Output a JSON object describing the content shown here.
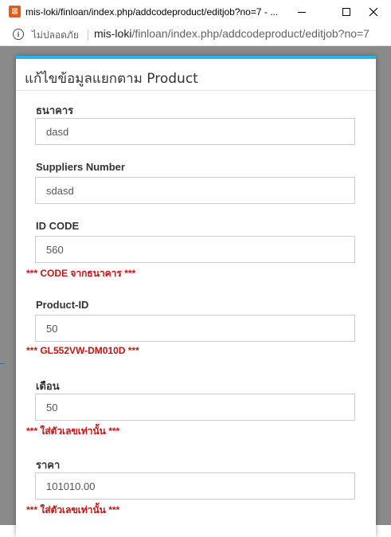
{
  "window": {
    "title": "mis-loki/finloan/index.php/addcodeproduct/editjob?no=7 - ...",
    "icon": "xampp-icon"
  },
  "addressbar": {
    "security_label": "ไม่ปลอดภัย",
    "url_host": "mis-loki",
    "url_path": "/finloan/index.php/addcodeproduct/editjob?no=7"
  },
  "modal": {
    "title": "แก้ไขข้อมูลแยกตาม Product",
    "accent_color": "#27b4e9",
    "fields": [
      {
        "label": "ธนาคาร",
        "value": "dasd",
        "hint": ""
      },
      {
        "label": "Suppliers Number",
        "value": "sdasd",
        "hint": ""
      },
      {
        "label": "ID CODE",
        "value": "560",
        "hint": "*** CODE จากธนาคาร ***"
      },
      {
        "label": "Product-ID",
        "value": "50",
        "hint": "*** GL552VW-DM010D ***"
      },
      {
        "label": "เดือน",
        "value": "50",
        "hint": "*** ใส่ตัวเลขเท่านั้น ***"
      },
      {
        "label": "ราคา",
        "value": "101010.00",
        "hint": "*** ใส่ตัวเลขเท่านั้น ***"
      }
    ]
  },
  "colors": {
    "hint": "#d01010"
  }
}
